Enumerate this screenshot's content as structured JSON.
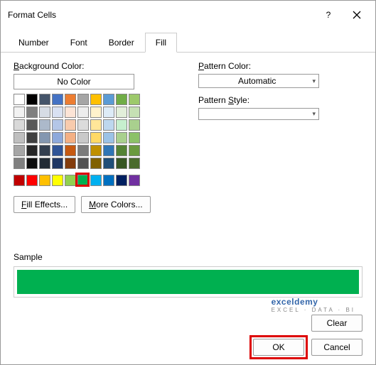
{
  "dialog": {
    "title": "Format Cells"
  },
  "tabs": {
    "number": "Number",
    "font": "Font",
    "border": "Border",
    "fill": "Fill",
    "active": "fill"
  },
  "leftPanel": {
    "bgColorLabel": "Background Color:",
    "noColor": "No Color",
    "fillEffects": "Fill Effects...",
    "moreColors": "More Colors..."
  },
  "rightPanel": {
    "patternColorLabel": "Pattern Color:",
    "patternColorValue": "Automatic",
    "patternStyleLabel": "Pattern Style:"
  },
  "themeColors": [
    "#ffffff",
    "#000000",
    "#44546a",
    "#4472c4",
    "#ed7d31",
    "#a5a5a5",
    "#ffc000",
    "#5b9bd5",
    "#70ad47",
    "#9dc96b",
    "#f2f2f2",
    "#808080",
    "#d6dce5",
    "#d9e1f2",
    "#fce4d6",
    "#ededed",
    "#fff2cc",
    "#ddebf7",
    "#e2efda",
    "#c6e0b4",
    "#d9d9d9",
    "#595959",
    "#acb9ca",
    "#b4c6e7",
    "#f8cbad",
    "#dbdbdb",
    "#ffe699",
    "#bdd7ee",
    "#c6efce",
    "#a9d08e",
    "#bfbfbf",
    "#404040",
    "#8497b0",
    "#8ea9db",
    "#f4b084",
    "#c9c9c9",
    "#ffd966",
    "#9bc2e6",
    "#a9d08e",
    "#8cc168",
    "#a6a6a6",
    "#262626",
    "#333f4f",
    "#305496",
    "#c65911",
    "#7b7b7b",
    "#bf8f00",
    "#2f75b5",
    "#548235",
    "#6a9a3f",
    "#808080",
    "#0d0d0d",
    "#222b35",
    "#203764",
    "#833c0c",
    "#525252",
    "#806000",
    "#1f4e78",
    "#375623",
    "#4a6b2d"
  ],
  "standardColors": [
    "#c00000",
    "#ff0000",
    "#ffc000",
    "#ffff00",
    "#92d050",
    "#00b050",
    "#00b0f0",
    "#0070c0",
    "#002060",
    "#7030a0"
  ],
  "selected": {
    "color": "#00b050",
    "stdIndex": 5
  },
  "sample": {
    "label": "Sample",
    "fill": "#00b050"
  },
  "footer": {
    "clear": "Clear",
    "ok": "OK",
    "cancel": "Cancel"
  },
  "watermark": {
    "brand": "exceldemy",
    "tagline": "EXCEL · DATA · BI"
  }
}
